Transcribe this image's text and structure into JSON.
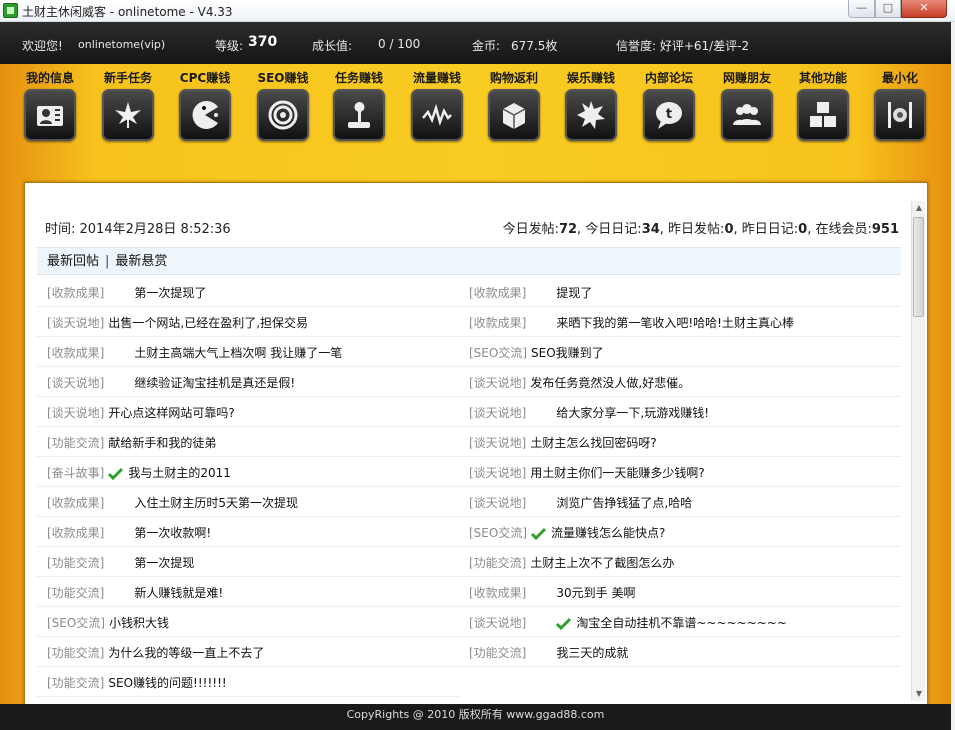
{
  "window": {
    "title": "土财主休闲威客 - onlinetome - V4.33"
  },
  "status": {
    "welcome": "欢迎您!",
    "username": "onlinetome(vip)",
    "level_label": "等级:",
    "level_value": "370",
    "growth_label": "成长值:",
    "growth_value": "0 / 100",
    "gold_label": "金币:",
    "gold_value": "677.5枚",
    "reputation": "信誉度: 好评+61/差评-2"
  },
  "nav": [
    {
      "label": "我的信息",
      "icon": "user-card-icon"
    },
    {
      "label": "新手任务",
      "icon": "leaf-icon"
    },
    {
      "label": "CPC赚钱",
      "icon": "pacman-icon"
    },
    {
      "label": "SEO赚钱",
      "icon": "swirl-icon"
    },
    {
      "label": "任务赚钱",
      "icon": "joystick-icon"
    },
    {
      "label": "流量赚钱",
      "icon": "wave-icon"
    },
    {
      "label": "购物返利",
      "icon": "box-icon"
    },
    {
      "label": "娱乐赚钱",
      "icon": "splash-icon"
    },
    {
      "label": "内部论坛",
      "icon": "chat-bubble-icon"
    },
    {
      "label": "网赚朋友",
      "icon": "friends-icon"
    },
    {
      "label": "其他功能",
      "icon": "cubes-icon"
    },
    {
      "label": "最小化",
      "icon": "minimize-icon"
    }
  ],
  "info": {
    "time": "时间: 2014年2月28日  8:52:36",
    "today_posts_label": "今日发帖:",
    "today_posts": "72",
    "today_diary_label": ", 今日日记:",
    "today_diary": "34",
    "yesterday_posts_label": ", 昨日发帖:",
    "yesterday_posts": "0",
    "yesterday_diary_label": ", 昨日日记:",
    "yesterday_diary": "0",
    "online_label": ", 在线会员:",
    "online": "951"
  },
  "tabs": {
    "latest_replies": "最新回帖",
    "separator": "|",
    "latest_rewards": "最新悬赏"
  },
  "posts_left": [
    {
      "category": "[收款成果]",
      "title": "第一次提现了",
      "indent": true,
      "checked": false
    },
    {
      "category": "[谈天说地]",
      "title": "出售一个网站,已经在盈利了,担保交易",
      "indent": false,
      "checked": false
    },
    {
      "category": "[收款成果]",
      "title": "土财主高端大气上档次啊 我让赚了一笔",
      "indent": true,
      "checked": false
    },
    {
      "category": "[谈天说地]",
      "title": "继续验证淘宝挂机是真还是假!",
      "indent": true,
      "checked": false
    },
    {
      "category": "[谈天说地]",
      "title": "开心点这样网站可靠吗?",
      "indent": false,
      "checked": false
    },
    {
      "category": "[功能交流]",
      "title": "献给新手和我的徒弟",
      "indent": false,
      "checked": false
    },
    {
      "category": "[奋斗故事]",
      "title": "我与土财主的2011",
      "indent": false,
      "checked": true
    },
    {
      "category": "[收款成果]",
      "title": "入住土财主历时5天第一次提现",
      "indent": true,
      "checked": false
    },
    {
      "category": "[收款成果]",
      "title": "第一次收款啊!",
      "indent": true,
      "checked": false
    },
    {
      "category": "[功能交流]",
      "title": "第一次提现",
      "indent": true,
      "checked": false
    },
    {
      "category": "[功能交流]",
      "title": "新人赚钱就是难!",
      "indent": true,
      "checked": false
    },
    {
      "category": "[SEO交流]",
      "title": "小钱积大钱",
      "indent": false,
      "checked": false
    },
    {
      "category": "[功能交流]",
      "title": "为什么我的等级一直上不去了",
      "indent": false,
      "checked": false
    },
    {
      "category": "[功能交流]",
      "title": "SEO赚钱的问题!!!!!!!",
      "indent": false,
      "checked": false
    }
  ],
  "posts_right": [
    {
      "category": "[收款成果]",
      "title": "提现了",
      "indent": true,
      "checked": false
    },
    {
      "category": "[收款成果]",
      "title": "来晒下我的第一笔收入吧!哈哈!土财主真心棒",
      "indent": true,
      "checked": false
    },
    {
      "category": "[SEO交流]",
      "title": "SEO我赚到了",
      "indent": false,
      "checked": false
    },
    {
      "category": "[谈天说地]",
      "title": "发布任务竟然没人做,好悲催。",
      "indent": false,
      "checked": false
    },
    {
      "category": "[谈天说地]",
      "title": "给大家分享一下,玩游戏赚钱!",
      "indent": true,
      "checked": false
    },
    {
      "category": "[谈天说地]",
      "title": "土财主怎么找回密码呀?",
      "indent": false,
      "checked": false
    },
    {
      "category": "[谈天说地]",
      "title": "用土财主你们一天能赚多少钱啊?",
      "indent": false,
      "checked": false
    },
    {
      "category": "[谈天说地]",
      "title": "浏览广告挣钱猛了点,哈哈",
      "indent": true,
      "checked": false
    },
    {
      "category": "[SEO交流]",
      "title": "流量赚钱怎么能快点?",
      "indent": false,
      "checked": true
    },
    {
      "category": "[功能交流]",
      "title": "土财主上次不了截图怎么办",
      "indent": false,
      "checked": false
    },
    {
      "category": "[收款成果]",
      "title": "30元到手 美啊",
      "indent": true,
      "checked": false
    },
    {
      "category": "[谈天说地]",
      "title": "淘宝全自动挂机不靠谱~~~~~~~~~",
      "indent": true,
      "checked": true
    },
    {
      "category": "[功能交流]",
      "title": "我三天的成就",
      "indent": true,
      "checked": false
    }
  ],
  "footer": {
    "text": "CopyRights @ 2010  版权所有  www.ggad88.com"
  },
  "colors": {
    "accent_yellow": "#f9cc22",
    "frame_dark": "#1f1f1f",
    "check_green": "#2ea02e"
  }
}
